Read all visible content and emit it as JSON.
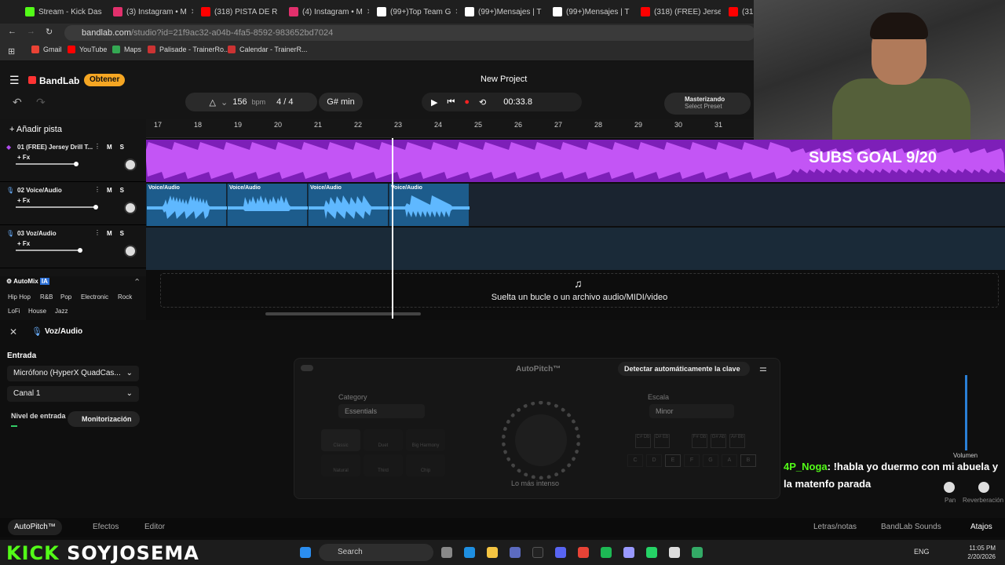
{
  "browser": {
    "tabs": [
      {
        "label": "Stream - Kick Das",
        "color": "#53fc18"
      },
      {
        "label": "(3) Instagram • M",
        "color": "#e1306c"
      },
      {
        "label": "(318) PISTA DE R",
        "color": "#ff0000"
      },
      {
        "label": "(4) Instagram • M",
        "color": "#e1306c"
      },
      {
        "label": "(99+)Top Team G",
        "color": "#ffffff"
      },
      {
        "label": "(99+)Mensajes | T",
        "color": "#ffffff"
      },
      {
        "label": "(99+)Mensajes | T",
        "color": "#ffffff"
      },
      {
        "label": "(318) (FREE) Jerse",
        "color": "#ff0000"
      },
      {
        "label": "(318) T",
        "color": "#ff0000"
      }
    ],
    "url_host": "bandlab.com",
    "url_path": "/studio?id=21f9ac32-a04b-4fa5-8592-983652bd7024",
    "bookmarks": [
      "Gmail",
      "YouTube",
      "Maps",
      "Palisade - TrainerRo...",
      "Calendar - TrainerR..."
    ]
  },
  "studio": {
    "logo": "BandLab",
    "obtener": "Obtener",
    "project_title": "New Project",
    "bpm": "156",
    "bpm_unit": "bpm",
    "time_sig": "4 / 4",
    "key": "G# min",
    "time": "00:33.8",
    "mastering_title": "Masterizando",
    "mastering_sub": "Select Preset",
    "add_track": "Añadir pista",
    "ruler": [
      "17",
      "18",
      "19",
      "20",
      "21",
      "22",
      "23",
      "24",
      "25",
      "26",
      "27",
      "28",
      "29",
      "30",
      "31"
    ],
    "tracks": [
      {
        "num": "01",
        "name": "(FREE) Jersey Drill T...",
        "fx": "+ Fx",
        "m": "M",
        "s": "S",
        "volume": 0.6
      },
      {
        "num": "02",
        "name": "Voice/Audio",
        "fx": "+ Fx",
        "m": "M",
        "s": "S",
        "volume": 0.8
      },
      {
        "num": "03",
        "name": "Voz/Audio",
        "fx": "+ Fx",
        "m": "M",
        "s": "S",
        "volume": 0.64
      }
    ],
    "clips": [
      "Voice/Audio",
      "Voice/Audio",
      "Voice/Audio",
      "Voice/Audio"
    ],
    "drop_text": "Suelta un bucle o un archivo audio/MIDI/video",
    "automix": {
      "label": "AutoMix",
      "badge": "IA",
      "genres": [
        "Hip Hop",
        "R&B",
        "Pop",
        "Electronic",
        "Rock",
        "LoFi",
        "House",
        "Jazz"
      ]
    },
    "overlay_subs": "SUBS GOAL 9/20"
  },
  "input_panel": {
    "track_name": "Voz/Audio",
    "entrada_label": "Entrada",
    "mic": "Micrófono (HyperX QuadCas...",
    "channel": "Canal 1",
    "level_label": "Nivel de entrada",
    "monitor": "Monitorización"
  },
  "autopitch": {
    "title": "AutoPitch™",
    "detect": "Detectar automáticamente la clave",
    "category_label": "Category",
    "category_value": "Essentials",
    "scale_label": "Escala",
    "scale_value": "Minor",
    "presets": [
      "Classic",
      "Duet",
      "Big Harmony",
      "Natural",
      "Third",
      "Chip"
    ],
    "knob_label": "Lo más intenso",
    "notes": [
      "C",
      "D",
      "E",
      "F",
      "G",
      "A",
      "B"
    ],
    "sharps": [
      "C# Db",
      "D# Eb",
      "F# Gb",
      "G# Ab",
      "A# Bb"
    ],
    "volume_label": "Volumen",
    "pan_label": "Pan",
    "reverb_label": "Reverberación"
  },
  "bottom_bar": {
    "autopitch": "AutoPitch™",
    "effects": "Efectos",
    "editor": "Editor",
    "lyrics": "Letras/notas",
    "sounds": "BandLab Sounds",
    "shortcuts": "Atajos"
  },
  "stream": {
    "kick_a": "KICK",
    "kick_b": "SOYJOSEMA",
    "chat_user": "4P_Noga",
    "chat_msg": ": !habla yo duermo con mi abuela y la matenfo parada"
  },
  "taskbar": {
    "search": "Search",
    "lang": "ENG",
    "time": "11:05 PM",
    "date": "2/20/2026"
  }
}
